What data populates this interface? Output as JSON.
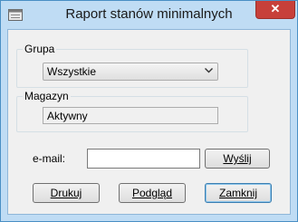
{
  "window": {
    "title": "Raport stanów minimalnych",
    "close_glyph": "✕",
    "app_icon": "window-app-icon"
  },
  "grupa": {
    "label": "Grupa",
    "selected": "Wszystkie",
    "arrow_glyph": "⌄"
  },
  "magazyn": {
    "label": "Magazyn",
    "value": "Aktywny"
  },
  "email": {
    "label": "e-mail:",
    "value": "",
    "send_label": "Wyślij"
  },
  "buttons": {
    "print": "Drukuj",
    "preview": "Podgląd",
    "close": "Zamknij"
  }
}
